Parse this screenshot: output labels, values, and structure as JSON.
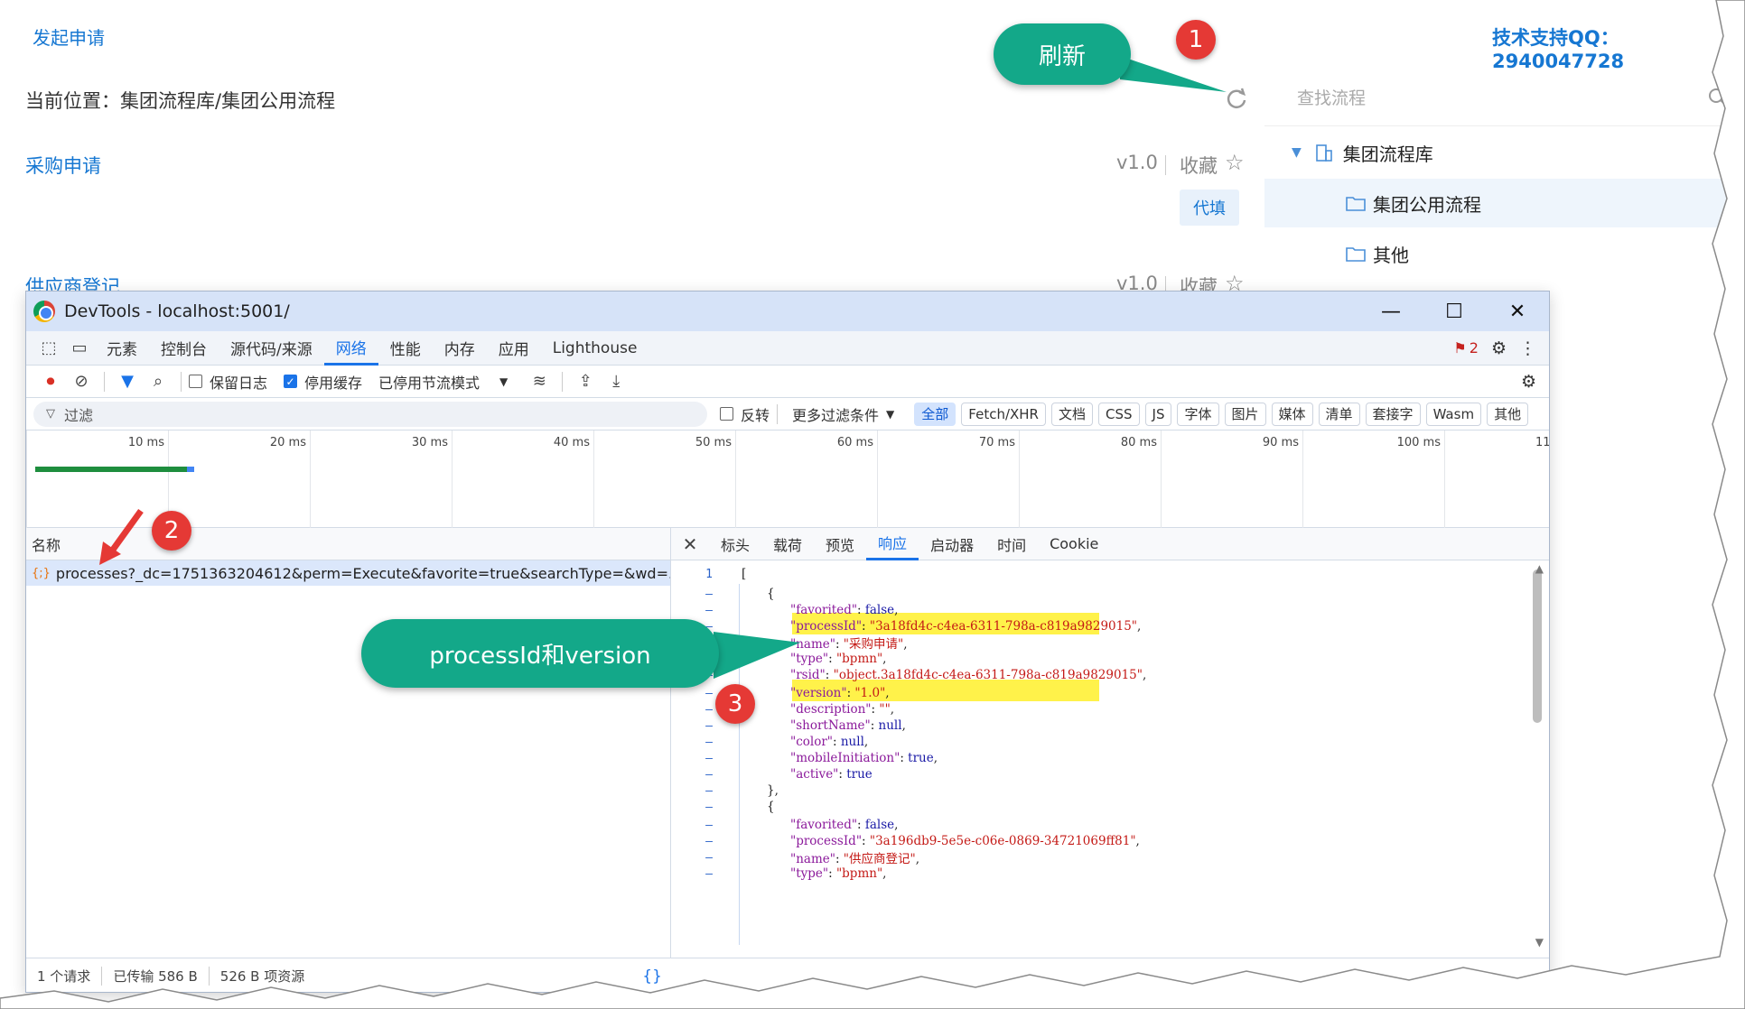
{
  "app": {
    "start_link": "发起申请",
    "breadcrumb": "当前位置：集团流程库/集团公用流程",
    "support": "技术支持QQ：2940047728",
    "search_placeholder": "查找流程",
    "tree": {
      "root": "集团流程库",
      "child1": "集团公用流程",
      "child2": "其他"
    },
    "processes": [
      {
        "name": "采购申请",
        "version": "v1.0",
        "favorite": "收藏",
        "action": "代填"
      },
      {
        "name": "供应商登记",
        "version": "v1.0",
        "favorite": "收藏"
      }
    ]
  },
  "devtools": {
    "title": "DevTools - localhost:5001/",
    "tabs": [
      "元素",
      "控制台",
      "源代码/来源",
      "网络",
      "性能",
      "内存",
      "应用",
      "Lighthouse"
    ],
    "active_tab": "网络",
    "issues_count": "2",
    "toolbar": {
      "preserve_log": "保留日志",
      "disable_cache": "停用缓存",
      "throttle": "已停用节流模式"
    },
    "filter": {
      "placeholder": "过滤",
      "invert": "反转",
      "more": "更多过滤条件"
    },
    "chips": [
      "全部",
      "Fetch/XHR",
      "文档",
      "CSS",
      "JS",
      "字体",
      "图片",
      "媒体",
      "清单",
      "套接字",
      "Wasm",
      "其他"
    ],
    "timeline_ticks": [
      "10 ms",
      "20 ms",
      "30 ms",
      "40 ms",
      "50 ms",
      "60 ms",
      "70 ms",
      "80 ms",
      "90 ms",
      "100 ms",
      "11"
    ],
    "name_header": "名称",
    "request": "processes?_dc=1751363204612&perm=Execute&favorite=true&searchType=&wd=...",
    "detail_tabs": [
      "标头",
      "载荷",
      "预览",
      "响应",
      "启动器",
      "时间",
      "Cookie"
    ],
    "active_detail_tab": "响应",
    "status": [
      "1 个请求",
      "已传输 586 B",
      "526 B 项资源"
    ]
  },
  "response_json": {
    "record1": {
      "favorited": "false",
      "processId": "\"3a18fd4c-c4ea-6311-798a-c819a9829015\"",
      "name": "\"采购申请\"",
      "type": "\"bpmn\"",
      "rsid": "\"object.3a18fd4c-c4ea-6311-798a-c819a9829015\"",
      "version": "\"1.0\"",
      "description": "\"\"",
      "shortName": "null",
      "color": "null",
      "mobileInitiation": "true",
      "active": "true"
    },
    "record2": {
      "favorited": "false",
      "processId": "\"3a196db9-5e5e-c06e-0869-34721069ff81\"",
      "name": "\"供应商登记\"",
      "type": "\"bpmn\""
    }
  },
  "annotations": {
    "refresh": "刷新",
    "fields": "processId和version",
    "n1": "1",
    "n2": "2",
    "n3": "3"
  },
  "colors": {
    "callout": "#13a889",
    "marker": "#e53935",
    "highlight": "#fff24a",
    "link": "#1677d2"
  }
}
